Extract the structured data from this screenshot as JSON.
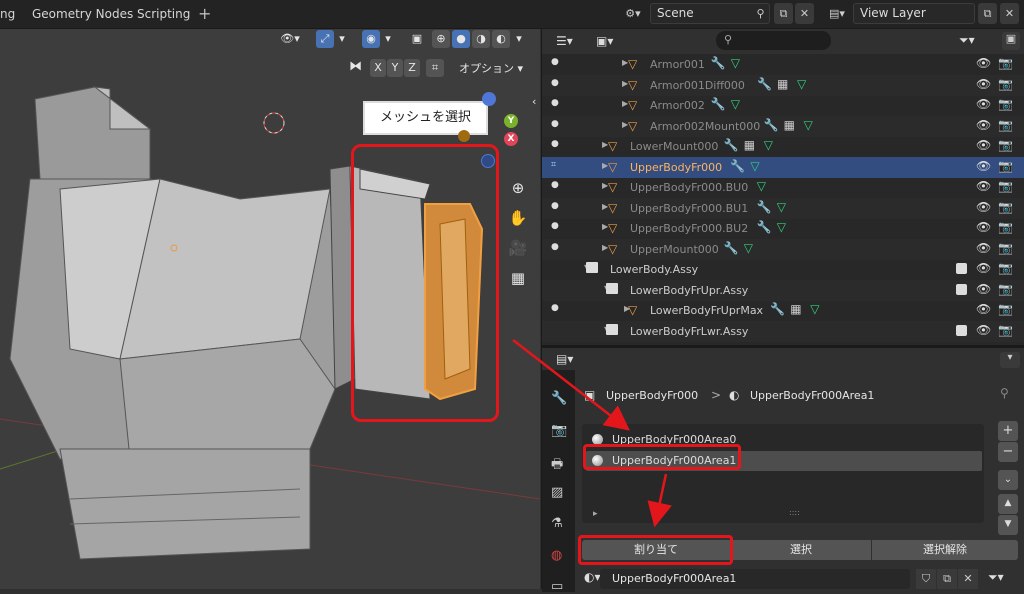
{
  "topbar": {
    "workspace_tabs": [
      "ng",
      "Geometry Nodes",
      "Scripting"
    ],
    "add_tab": "+",
    "scene_label": "Scene",
    "view_layer_label": "View Layer"
  },
  "viewport": {
    "axis_x": "X",
    "axis_y": "Y",
    "axis_z": "Z",
    "options_label": "オプション",
    "callout_text": "メッシュを選択",
    "gizmo_y": "Y",
    "gizmo_x": "X"
  },
  "outliner": {
    "rows": [
      {
        "label": "Armor001",
        "dim": true
      },
      {
        "label": "Armor001Diff000",
        "dim": true
      },
      {
        "label": "Armor002",
        "dim": true
      },
      {
        "label": "Armor002Mount000",
        "dim": true
      },
      {
        "label": "LowerMount000",
        "dim": true
      },
      {
        "label": "UpperBodyFr000",
        "dim": false
      },
      {
        "label": "UpperBodyFr000.BU0",
        "dim": true
      },
      {
        "label": "UpperBodyFr000.BU1",
        "dim": true
      },
      {
        "label": "UpperBodyFr000.BU2",
        "dim": true
      },
      {
        "label": "UpperMount000",
        "dim": true
      },
      {
        "label": "LowerBody.Assy",
        "dim": false
      },
      {
        "label": "LowerBodyFrUpr.Assy",
        "dim": false
      },
      {
        "label": "LowerBodyFrUprMax",
        "dim": false
      },
      {
        "label": "LowerBodyFrLwr.Assy",
        "dim": false
      }
    ]
  },
  "properties": {
    "breadcrumb_object": "UpperBodyFr000",
    "breadcrumb_sep": ">",
    "breadcrumb_material": "UpperBodyFr000Area1",
    "slots": [
      "UpperBodyFr000Area0",
      "UpperBodyFr000Area1"
    ],
    "list_expand": "▸",
    "list_grip": "::::",
    "assign_label": "割り当て",
    "select_label": "選択",
    "deselect_label": "選択解除",
    "material_name": "UpperBodyFr000Area1"
  },
  "colors": {
    "accent_red": "#e3161b",
    "selection_blue": "#334d80",
    "object_orange": "#e69b45",
    "mesh_green": "#2ed17f"
  }
}
